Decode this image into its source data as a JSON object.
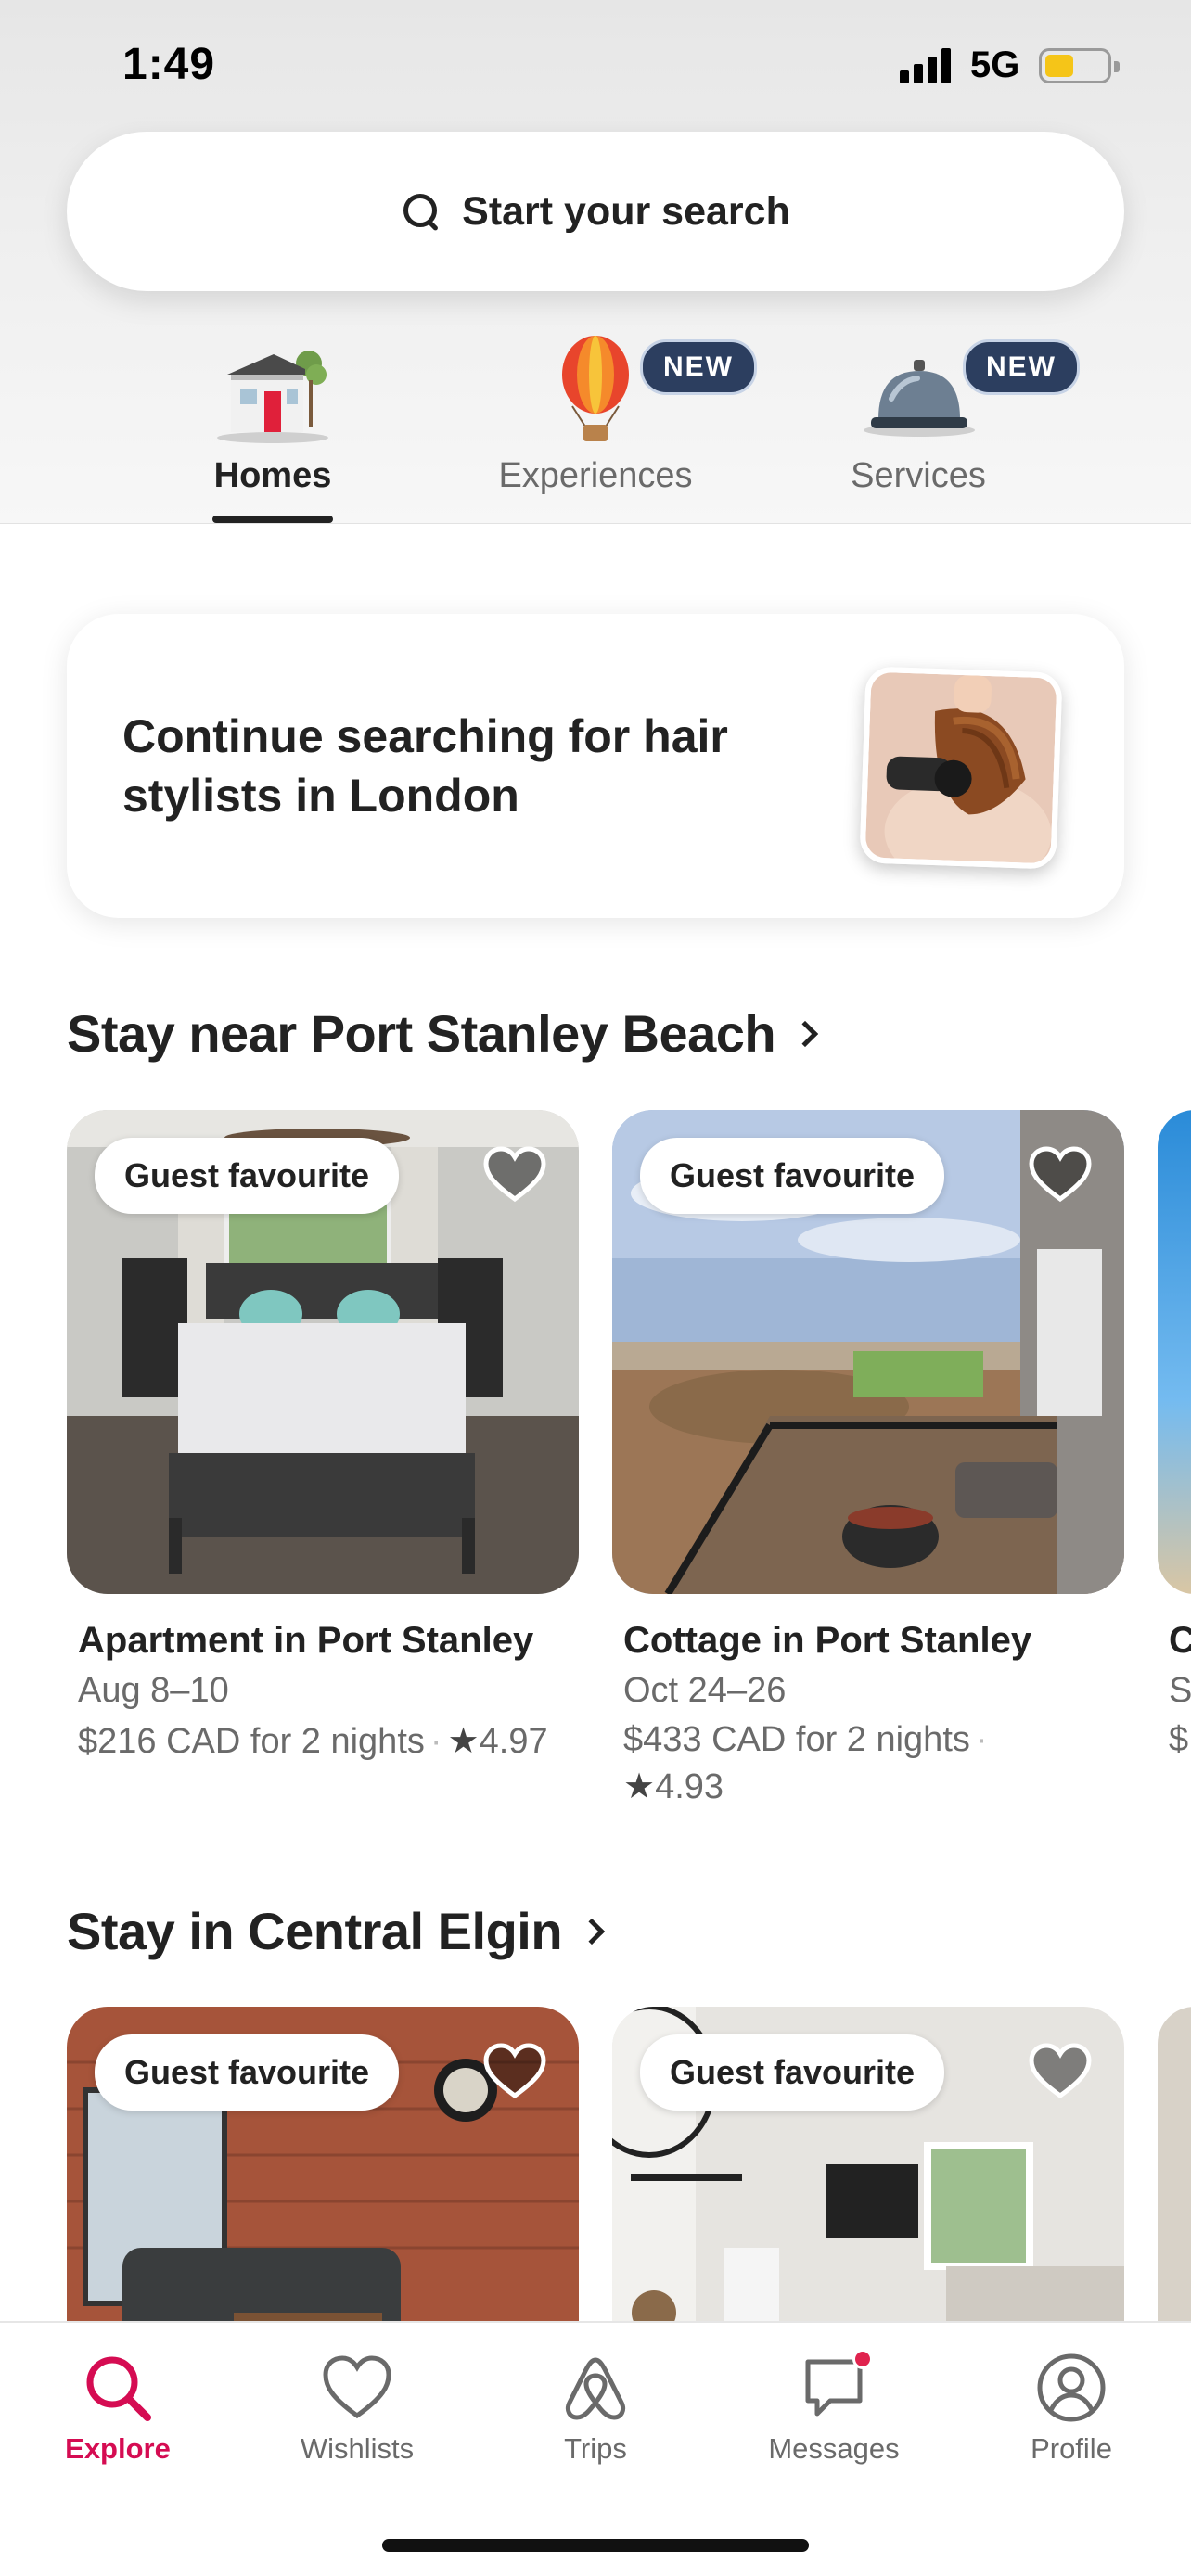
{
  "status_bar": {
    "time": "1:49",
    "network": "5G",
    "battery_level": 0.45
  },
  "search": {
    "label": "Start your search"
  },
  "categories": [
    {
      "label": "Homes",
      "icon": "house-icon",
      "active": true,
      "badge": ""
    },
    {
      "label": "Experiences",
      "icon": "hot-air-balloon-icon",
      "active": false,
      "badge": "NEW"
    },
    {
      "label": "Services",
      "icon": "service-bell-icon",
      "active": false,
      "badge": "NEW"
    }
  ],
  "continue_card": {
    "text": "Continue searching for hair stylists in London",
    "image": "hair-stylist-photo"
  },
  "sections": [
    {
      "title": "Stay near Port Stanley Beach",
      "listings": [
        {
          "badge": "Guest favourite",
          "title": "Apartment in Port Stanley",
          "dates": "Aug 8–10",
          "price": "$216 CAD for 2 nights",
          "rating": "4.97",
          "wishlisted": false
        },
        {
          "badge": "Guest favourite",
          "title": "Cottage in Port Stanley",
          "dates": "Oct 24–26",
          "price": "$433 CAD for 2 nights",
          "rating": "4.93",
          "wishlisted": false
        }
      ],
      "peek": {
        "title_start": "C",
        "dates_start": "S",
        "price_start": "$"
      }
    },
    {
      "title": "Stay in Central Elgin",
      "listings": [
        {
          "badge": "Guest favourite",
          "wishlisted": false
        },
        {
          "badge": "Guest favourite",
          "wishlisted": false
        }
      ]
    }
  ],
  "bottom_nav": [
    {
      "label": "Explore",
      "icon": "search-icon",
      "active": true
    },
    {
      "label": "Wishlists",
      "icon": "heart-icon",
      "active": false
    },
    {
      "label": "Trips",
      "icon": "airbnb-logo-icon",
      "active": false
    },
    {
      "label": "Messages",
      "icon": "message-icon",
      "active": false,
      "unread": true
    },
    {
      "label": "Profile",
      "icon": "profile-icon",
      "active": false
    }
  ],
  "colors": {
    "accent": "#d50c52",
    "text": "#222222",
    "muted": "#6a6a6a",
    "badge_bg": "#2c3e5f"
  }
}
